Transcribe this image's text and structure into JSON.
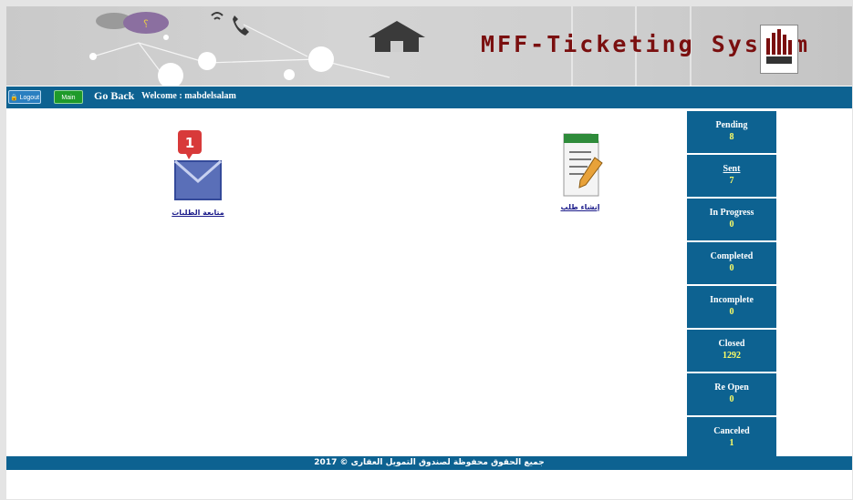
{
  "banner": {
    "title": "MFF-Ticketing System",
    "icons": [
      "chat-bubbles-icon",
      "phone-icon",
      "home-icon",
      "company-logo"
    ]
  },
  "nav": {
    "logout_label": "Logout",
    "main_page_label": "Main Page",
    "go_back_label": "Go Back",
    "welcome_text": "Welcome : mabdelsalam"
  },
  "tiles": {
    "follow_requests": {
      "label": "متابعة الطلبات",
      "badge": "1",
      "icon": "envelope-icon"
    },
    "create_request": {
      "label": "إنشاء طلب",
      "icon": "document-pencil-icon"
    }
  },
  "stats": [
    {
      "name": "Pending",
      "count": "8"
    },
    {
      "name": "Sent",
      "count": "7"
    },
    {
      "name": "In Progress",
      "count": "0"
    },
    {
      "name": "Completed",
      "count": "0"
    },
    {
      "name": "Incomplete",
      "count": "0"
    },
    {
      "name": "Closed",
      "count": "1292"
    },
    {
      "name": "Re Open",
      "count": "0"
    },
    {
      "name": "Canceled",
      "count": "1"
    }
  ],
  "footer": {
    "text": "جميع الحقوق محفوظة لصندوق التمويل العقارى © 2017"
  },
  "colors": {
    "nav_blue": "#0d6291",
    "title_red": "#7a0f0f",
    "count_yellow": "#ffff66"
  }
}
